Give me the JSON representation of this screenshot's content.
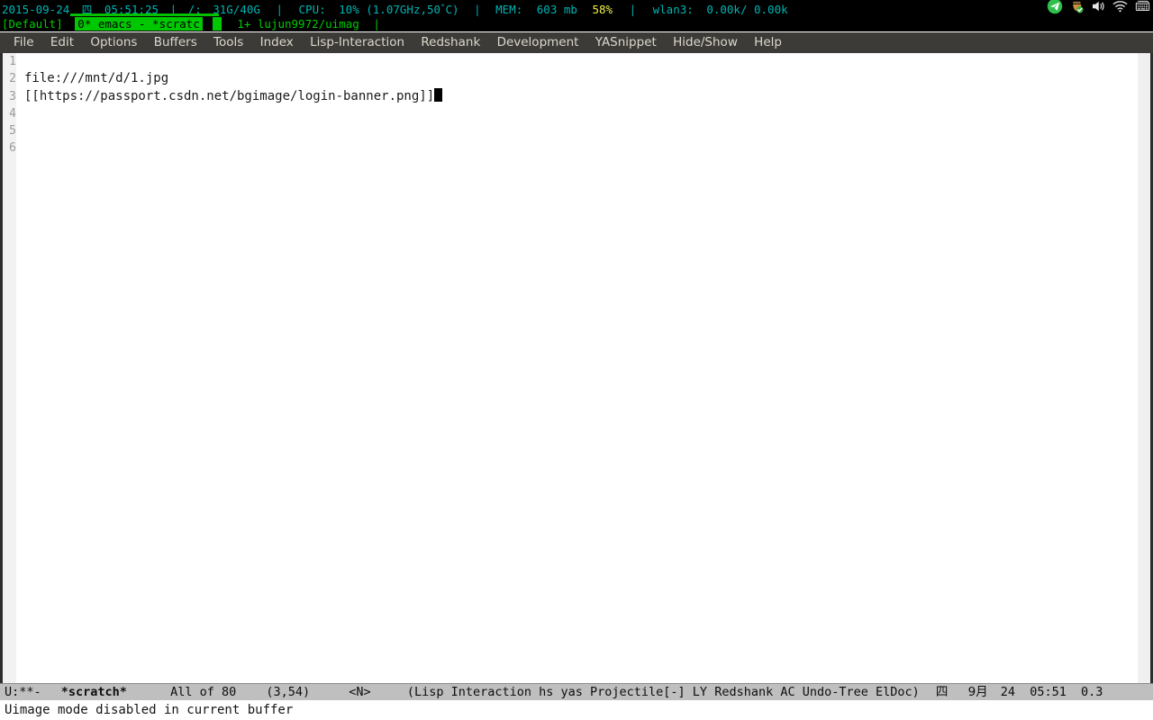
{
  "statusbar": {
    "date": "2015-09-24",
    "weekday_cjk": "四",
    "time": "05:51:25",
    "sep": "|",
    "disk_label": "/:",
    "disk_value": "31G/40G",
    "cpu_label": "CPU:",
    "cpu_value": "10% (1.07GHz,50",
    "cpu_degree": "°",
    "cpu_value_tail": "C)",
    "mem_label": "MEM:",
    "mem_value": "603 mb",
    "mem_percent": "58%",
    "net_label": "wlan3:",
    "net_value": "0.00k/ 0.00k",
    "colors": {
      "background": "#000000",
      "cyan": "#00b4b4",
      "yellow": "#f2f24a",
      "green": "#00c000"
    },
    "tray_icons": [
      "telegram-icon",
      "acorn-sync-icon",
      "volume-icon",
      "wifi-icon",
      "keyboard-icon"
    ]
  },
  "taskbar": {
    "desktop_label": "[Default]",
    "active_window": "0* emacs - *scratc",
    "active_tail": "|",
    "other_window": "1+ lujun9972/uimag",
    "trailing_pipe": "|",
    "colors": {
      "background": "#000000",
      "text": "#00cc00",
      "active_background": "#00c800",
      "active_text": "#000000"
    }
  },
  "menubar": {
    "items": [
      {
        "label": "File"
      },
      {
        "label": "Edit"
      },
      {
        "label": "Options"
      },
      {
        "label": "Buffers"
      },
      {
        "label": "Tools"
      },
      {
        "label": "Index"
      },
      {
        "label": "Lisp-Interaction"
      },
      {
        "label": "Redshank"
      },
      {
        "label": "Development"
      },
      {
        "label": "YASnippet"
      },
      {
        "label": "Hide/Show"
      },
      {
        "label": "Help"
      }
    ],
    "colors": {
      "background": "#3c3b37",
      "text": "#dcd7cc"
    }
  },
  "buffer": {
    "lines": [
      {
        "number": "1",
        "text": ""
      },
      {
        "number": "2",
        "text": "file:///mnt/d/1.jpg"
      },
      {
        "number": "3",
        "text": "[[https://passport.csdn.net/bgimage/login-banner.png]]"
      },
      {
        "number": "4",
        "text": ""
      },
      {
        "number": "5",
        "text": ""
      },
      {
        "number": "6",
        "text": ""
      }
    ],
    "cursor_line": 3,
    "colors": {
      "background": "#ffffff",
      "text": "#1a1a1a",
      "linenumber": "#9a9a9a",
      "gutter": "#f2f2f2"
    }
  },
  "modeline": {
    "encoding": "U:**-",
    "buffer_name": "*scratch*",
    "position_all": "All of 80",
    "cursor_pos": "(3,54)",
    "evil_state": "<N>",
    "modes": "(Lisp Interaction hs yas Projectile[-] LY Redshank AC Undo-Tree ElDoc)",
    "weekday_cjk": "四",
    "month_cjk": "9月",
    "day": "24",
    "time": "05:51",
    "load": "0.3",
    "colors": {
      "background": "#bfbfbf",
      "text": "#0e0e0e"
    }
  },
  "echoarea": {
    "message": "Uimage mode disabled in current buffer"
  }
}
